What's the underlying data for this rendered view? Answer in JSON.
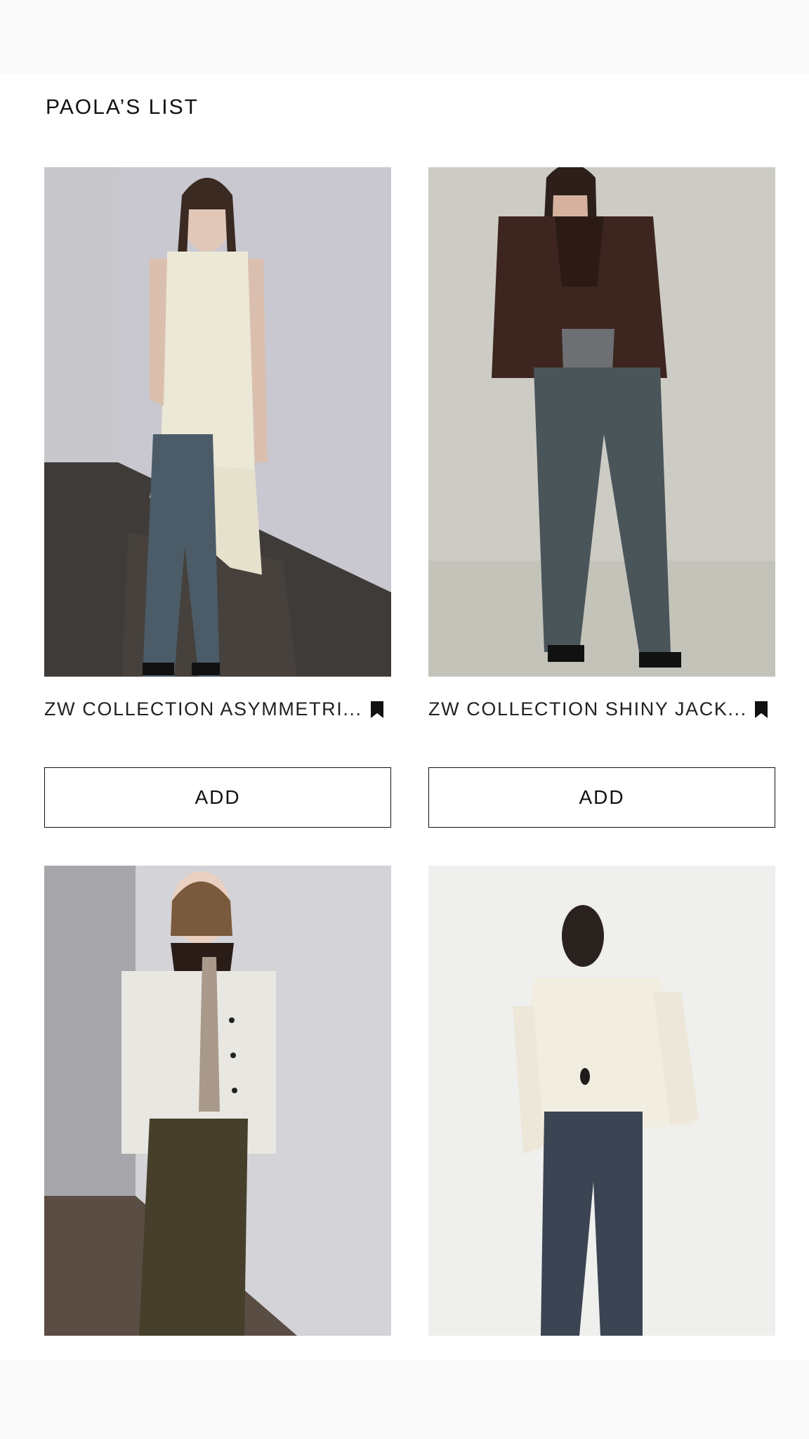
{
  "list": {
    "title": "PAOLA’S LIST"
  },
  "products": [
    {
      "name": "ZW COLLECTION ASYMMETRI...",
      "add_label": "ADD",
      "image_icon": "product-photo-satin-slip-dress"
    },
    {
      "name": "ZW COLLECTION SHINY JACK...",
      "add_label": "ADD",
      "image_icon": "product-photo-shiny-jacket"
    },
    {
      "image_icon": "product-photo-cream-jacket"
    },
    {
      "image_icon": "product-photo-ruffle-blouse"
    }
  ],
  "icons": {
    "save": "bookmark-icon"
  },
  "colors": {
    "text": "#111111",
    "background": "#ffffff",
    "page": "#fafafa"
  }
}
